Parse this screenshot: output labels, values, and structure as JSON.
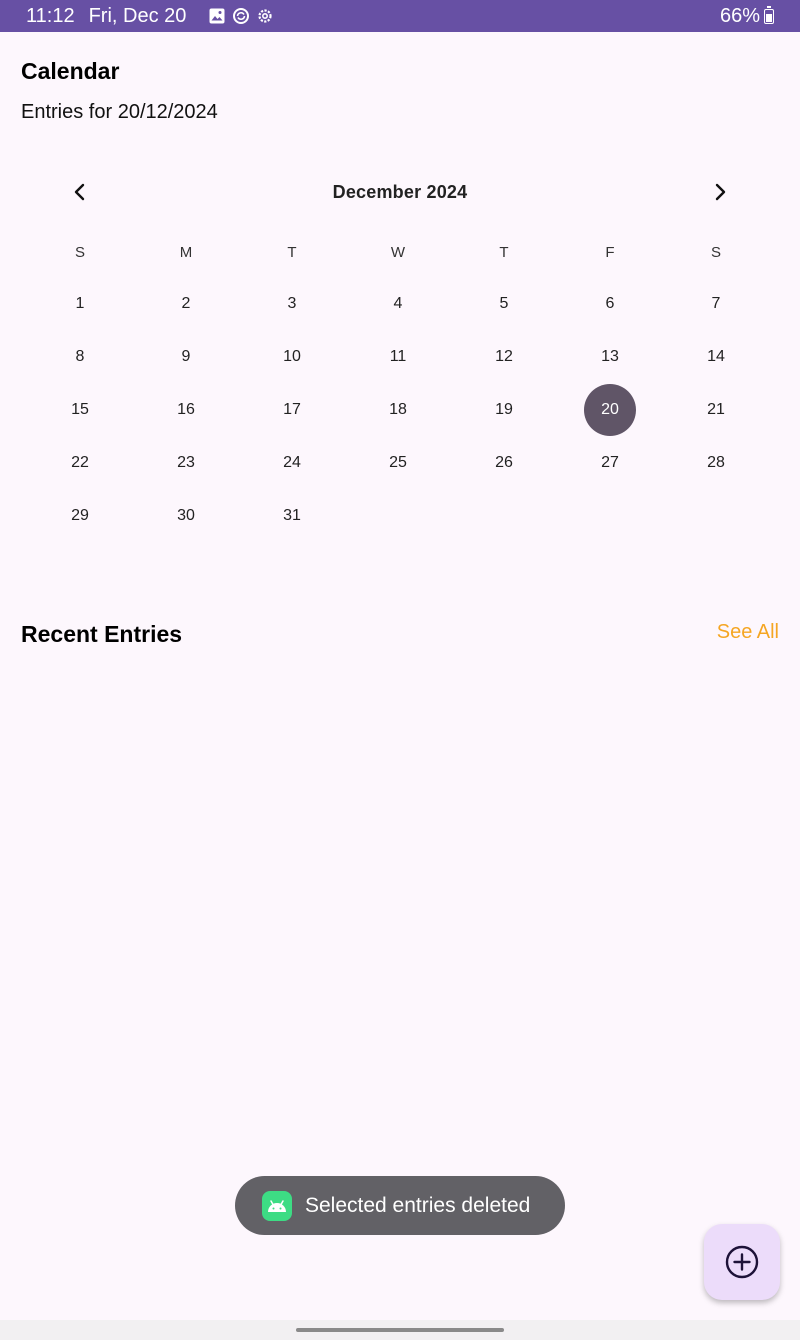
{
  "status_bar": {
    "time": "11:12",
    "date": "Fri, Dec 20",
    "battery": "66%",
    "icons": [
      "image-icon",
      "sync-icon",
      "settings-icon"
    ]
  },
  "header": {
    "title": "Calendar",
    "subtitle": "Entries for 20/12/2024"
  },
  "calendar": {
    "month_label": "December 2024",
    "weekdays": [
      "S",
      "M",
      "T",
      "W",
      "T",
      "F",
      "S"
    ],
    "weeks": [
      [
        "1",
        "2",
        "3",
        "4",
        "5",
        "6",
        "7"
      ],
      [
        "8",
        "9",
        "10",
        "11",
        "12",
        "13",
        "14"
      ],
      [
        "15",
        "16",
        "17",
        "18",
        "19",
        "20",
        "21"
      ],
      [
        "22",
        "23",
        "24",
        "25",
        "26",
        "27",
        "28"
      ],
      [
        "29",
        "30",
        "31",
        "",
        "",
        "",
        ""
      ]
    ],
    "selected_day": "20",
    "selected_color": "#605567"
  },
  "recent": {
    "title": "Recent Entries",
    "see_all": "See All",
    "accent_color": "#f5a623"
  },
  "toast": {
    "message": "Selected entries deleted"
  },
  "fab": {
    "icon": "add-circle-icon"
  }
}
